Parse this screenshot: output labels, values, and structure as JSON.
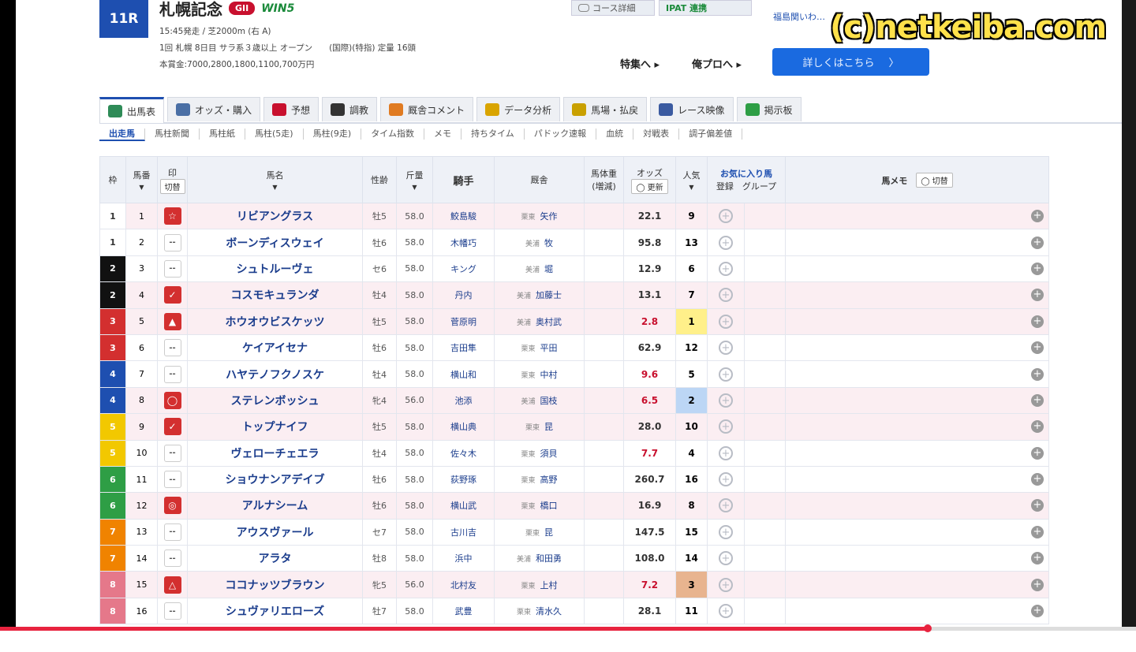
{
  "race": {
    "number": "11R",
    "name": "札幌記念",
    "grade": "GII",
    "win5": "WIN5",
    "line1": "15:45発走 / 芝2000m (右 A)",
    "line2": "1回 札幌 8日目 サラ系３歳以上 オープン　　(国際)(特指) 定量 16頭",
    "line3": "本賞金:7000,2800,1800,1100,700万円"
  },
  "top": {
    "course_btn": "コース詳細",
    "ipat_btn": "IPAT 連携",
    "link_text": "福島関いわ… ",
    "feature_link": "特集へ ▸",
    "pro_link": "俺プロへ ▸",
    "cta": "詳しくはこちら",
    "cta_arrow": "〉"
  },
  "watermark": "(c)netkeiba.com",
  "tabs": [
    {
      "label": "出馬表",
      "color": "#2e8b57"
    },
    {
      "label": "オッズ・購入",
      "color": "#4a6fa5"
    },
    {
      "label": "予想",
      "color": "#c8102e"
    },
    {
      "label": "調教",
      "color": "#333333"
    },
    {
      "label": "厩舎コメント",
      "color": "#e07b22"
    },
    {
      "label": "データ分析",
      "color": "#d9a400"
    },
    {
      "label": "馬場・払戻",
      "color": "#c9a000"
    },
    {
      "label": "レース映像",
      "color": "#3a5aa0"
    },
    {
      "label": "掲示板",
      "color": "#2e9e45"
    }
  ],
  "subtabs": [
    "出走馬",
    "馬柱新聞",
    "馬柱紙",
    "馬柱(5走)",
    "馬柱(9走)",
    "タイム指数",
    "メモ",
    "持ちタイム",
    "パドック速報",
    "血統",
    "対戦表",
    "調子偏差値"
  ],
  "headers": {
    "waku": "枠",
    "umaban": "馬番",
    "mark": "印",
    "mark_btn": "切替",
    "name": "馬名",
    "sex": "性齢",
    "kin": "斤量",
    "jockey": "騎手",
    "trainer": "厩舎",
    "weight": "馬体重",
    "weight_sub": "(増減)",
    "odds": "オッズ",
    "odds_btn": "◯ 更新",
    "ninki": "人気",
    "fav": "お気に入り馬",
    "fav_reg": "登録",
    "fav_group": "グループ",
    "memo": "馬メモ",
    "memo_btn": "◯ 切替"
  },
  "rows": [
    {
      "waku": "1",
      "umaban": "1",
      "mark": "☆",
      "name": "リビアングラス",
      "sex": "牡5",
      "kin": "58.0",
      "jockey": "鮫島駿",
      "reg": "栗東",
      "trainer": "矢作",
      "odds": "22.1",
      "ninki": "9",
      "hot": false
    },
    {
      "waku": "1",
      "umaban": "2",
      "mark": "--",
      "name": "ボーンディスウェイ",
      "sex": "牡6",
      "kin": "58.0",
      "jockey": "木幡巧",
      "reg": "美浦",
      "trainer": "牧",
      "odds": "95.8",
      "ninki": "13",
      "hot": false
    },
    {
      "waku": "2",
      "umaban": "3",
      "mark": "--",
      "name": "シュトルーヴェ",
      "sex": "セ6",
      "kin": "58.0",
      "jockey": "キング",
      "reg": "美浦",
      "trainer": "堀",
      "odds": "12.9",
      "ninki": "6",
      "hot": false
    },
    {
      "waku": "2",
      "umaban": "4",
      "mark": "✓",
      "name": "コスモキュランダ",
      "sex": "牡4",
      "kin": "58.0",
      "jockey": "丹内",
      "reg": "美浦",
      "trainer": "加藤士",
      "odds": "13.1",
      "ninki": "7",
      "hot": false
    },
    {
      "waku": "3",
      "umaban": "5",
      "mark": "▲",
      "name": "ホウオウビスケッツ",
      "sex": "牡5",
      "kin": "58.0",
      "jockey": "菅原明",
      "reg": "美浦",
      "trainer": "奥村武",
      "odds": "2.8",
      "ninki": "1",
      "hot": true
    },
    {
      "waku": "3",
      "umaban": "6",
      "mark": "--",
      "name": "ケイアイセナ",
      "sex": "牡6",
      "kin": "58.0",
      "jockey": "吉田隼",
      "reg": "栗東",
      "trainer": "平田",
      "odds": "62.9",
      "ninki": "12",
      "hot": false
    },
    {
      "waku": "4",
      "umaban": "7",
      "mark": "--",
      "name": "ハヤテノフクノスケ",
      "sex": "牡4",
      "kin": "58.0",
      "jockey": "横山和",
      "reg": "栗東",
      "trainer": "中村",
      "odds": "9.6",
      "ninki": "5",
      "hot": true
    },
    {
      "waku": "4",
      "umaban": "8",
      "mark": "◯",
      "name": "ステレンボッシュ",
      "sex": "牝4",
      "kin": "56.0",
      "jockey": "池添",
      "reg": "美浦",
      "trainer": "国枝",
      "odds": "6.5",
      "ninki": "2",
      "hot": true
    },
    {
      "waku": "5",
      "umaban": "9",
      "mark": "✓",
      "name": "トップナイフ",
      "sex": "牡5",
      "kin": "58.0",
      "jockey": "横山典",
      "reg": "栗東",
      "trainer": "昆",
      "odds": "28.0",
      "ninki": "10",
      "hot": false
    },
    {
      "waku": "5",
      "umaban": "10",
      "mark": "--",
      "name": "ヴェローチェエラ",
      "sex": "牡4",
      "kin": "58.0",
      "jockey": "佐々木",
      "reg": "栗東",
      "trainer": "須貝",
      "odds": "7.7",
      "ninki": "4",
      "hot": true
    },
    {
      "waku": "6",
      "umaban": "11",
      "mark": "--",
      "name": "ショウナンアデイブ",
      "sex": "牡6",
      "kin": "58.0",
      "jockey": "荻野琢",
      "reg": "栗東",
      "trainer": "高野",
      "odds": "260.7",
      "ninki": "16",
      "hot": false
    },
    {
      "waku": "6",
      "umaban": "12",
      "mark": "◎",
      "name": "アルナシーム",
      "sex": "牡6",
      "kin": "58.0",
      "jockey": "横山武",
      "reg": "栗東",
      "trainer": "橋口",
      "odds": "16.9",
      "ninki": "8",
      "hot": false
    },
    {
      "waku": "7",
      "umaban": "13",
      "mark": "--",
      "name": "アウスヴァール",
      "sex": "セ7",
      "kin": "58.0",
      "jockey": "古川吉",
      "reg": "栗東",
      "trainer": "昆",
      "odds": "147.5",
      "ninki": "15",
      "hot": false
    },
    {
      "waku": "7",
      "umaban": "14",
      "mark": "--",
      "name": "アラタ",
      "sex": "牡8",
      "kin": "58.0",
      "jockey": "浜中",
      "reg": "美浦",
      "trainer": "和田勇",
      "odds": "108.0",
      "ninki": "14",
      "hot": false
    },
    {
      "waku": "8",
      "umaban": "15",
      "mark": "△",
      "name": "ココナッツブラウン",
      "sex": "牝5",
      "kin": "56.0",
      "jockey": "北村友",
      "reg": "栗東",
      "trainer": "上村",
      "odds": "7.2",
      "ninki": "3",
      "hot": true
    },
    {
      "waku": "8",
      "umaban": "16",
      "mark": "--",
      "name": "シュヴァリエローズ",
      "sex": "牡7",
      "kin": "58.0",
      "jockey": "武豊",
      "reg": "栗東",
      "trainer": "清水久",
      "odds": "28.1",
      "ninki": "11",
      "hot": false
    }
  ],
  "waku_colors": {
    "1": "#ffffff",
    "2": "#111111",
    "3": "#d32f2f",
    "4": "#1e4fb0",
    "5": "#f2c800",
    "6": "#2e9e45",
    "7": "#f08300",
    "8": "#e5788a"
  },
  "ninki_colors": {
    "1": "#fff08a",
    "2": "#bcd6f5",
    "3": "#e8b48f"
  },
  "progress": {
    "played_fraction": 0.817
  }
}
